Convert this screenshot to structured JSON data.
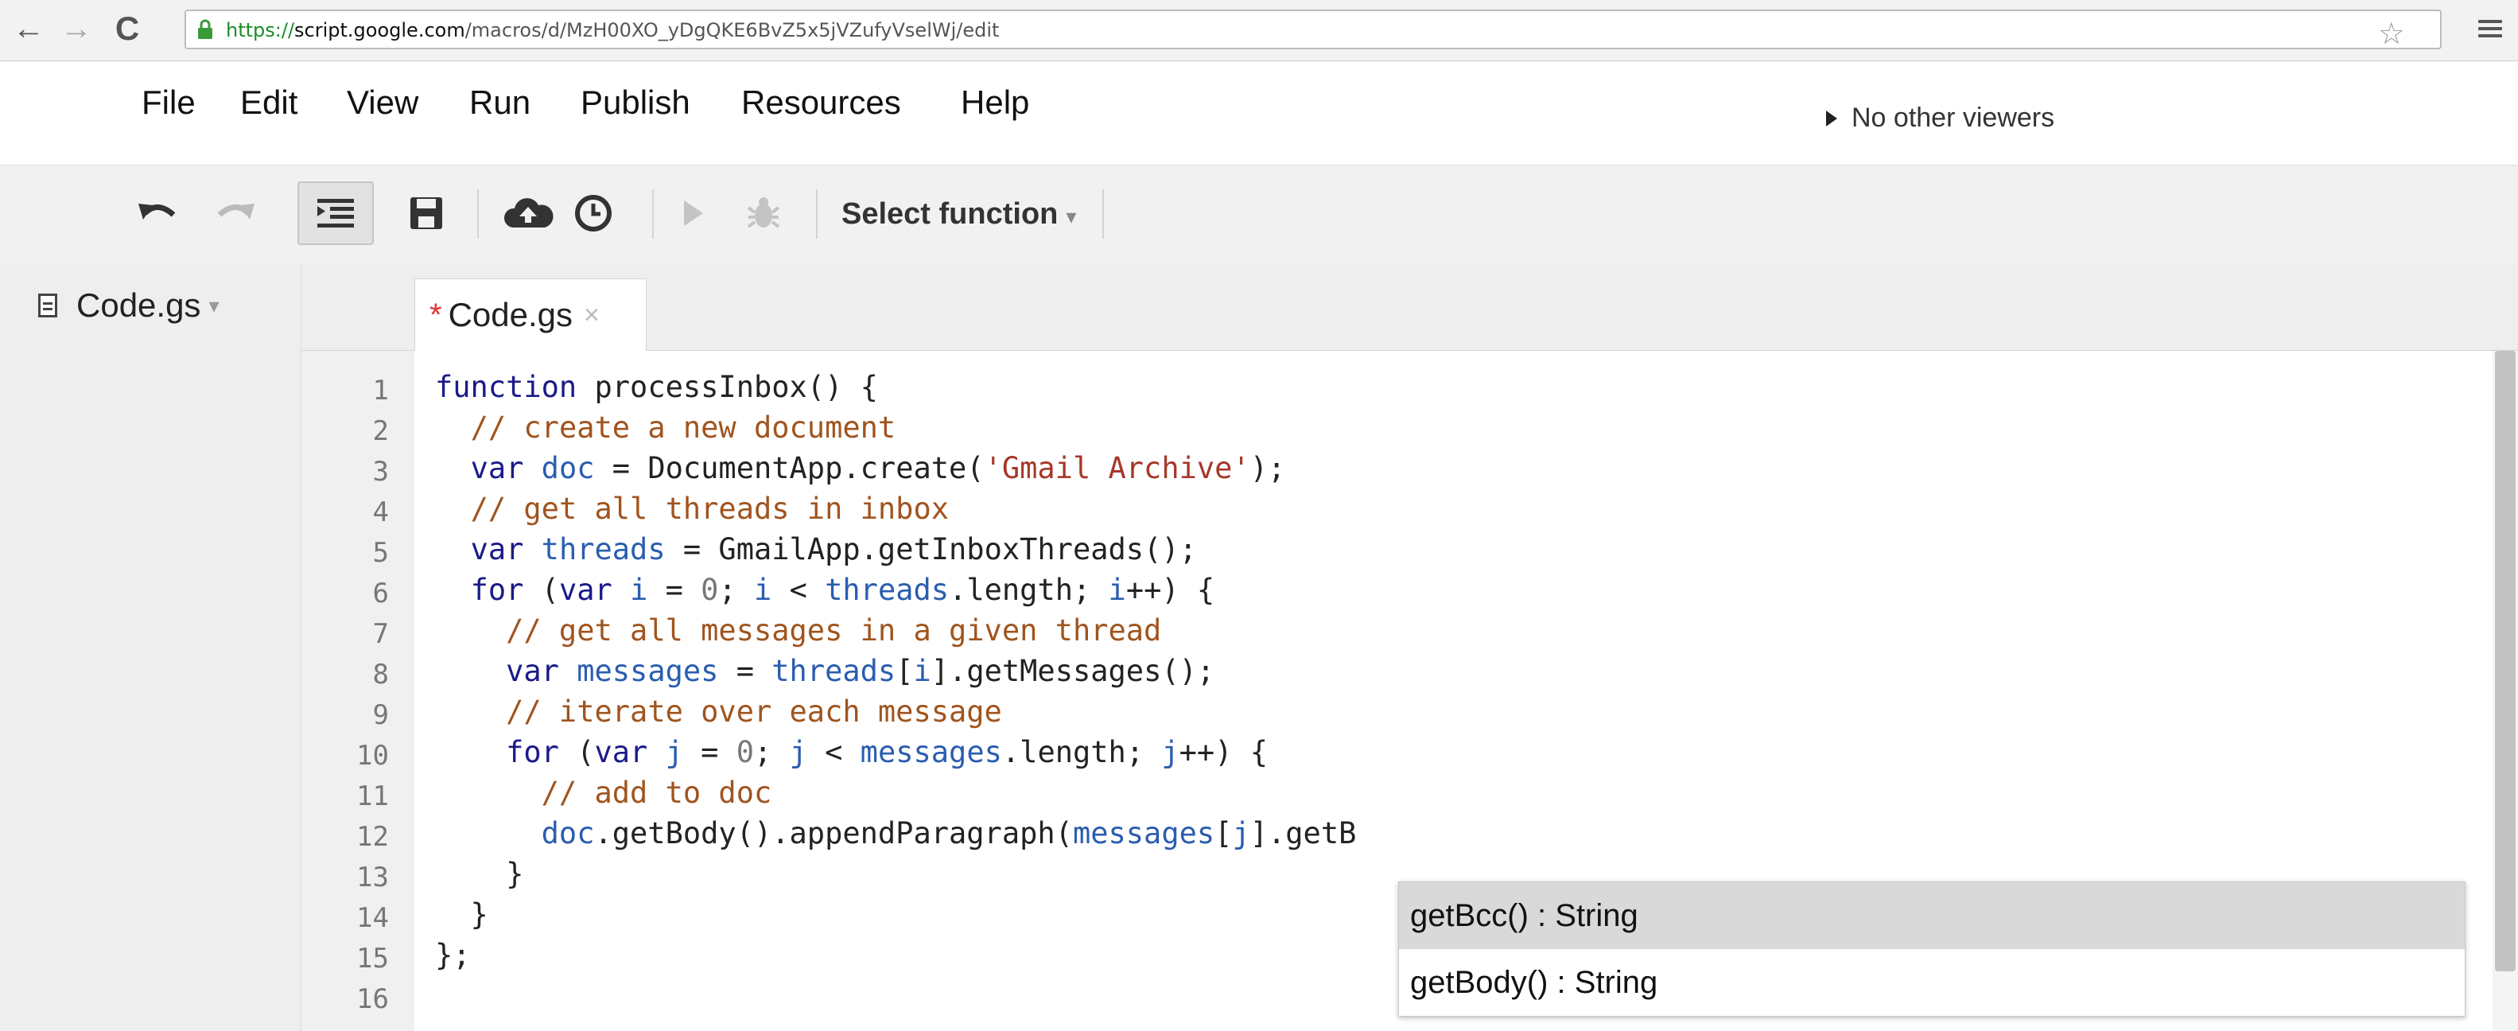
{
  "browser": {
    "url_protocol": "https",
    "url_host": "script.google.com",
    "url_path": "/macros/d/MzH00XO_yDgQKE6BvZ5x5jVZufyVselWj/edit"
  },
  "menu": {
    "items": [
      "File",
      "Edit",
      "View",
      "Run",
      "Publish",
      "Resources",
      "Help"
    ],
    "viewers": "No other viewers"
  },
  "toolbar": {
    "select_function": "Select function"
  },
  "files": {
    "sidebar_file": "Code.gs",
    "active_tab": "Code.gs",
    "tab_modified": "*",
    "tab_close": "×"
  },
  "editor": {
    "line_numbers": [
      "1",
      "2",
      "3",
      "4",
      "5",
      "6",
      "7",
      "8",
      "9",
      "10",
      "11",
      "12",
      "13",
      "14",
      "15",
      "16"
    ],
    "lines": [
      "function processInbox() {",
      "  // create a new document",
      "  var doc = DocumentApp.create('Gmail Archive');",
      "  // get all threads in inbox",
      "  var threads = GmailApp.getInboxThreads();",
      "  for (var i = 0; i < threads.length; i++) {",
      "    // get all messages in a given thread",
      "    var messages = threads[i].getMessages();",
      "    // iterate over each message",
      "    for (var j = 0; j < messages.length; j++) {",
      "      // add to doc",
      "      doc.getBody().appendParagraph(messages[j].getB",
      "    }",
      "  }",
      "};",
      ""
    ]
  },
  "autocomplete": {
    "items": [
      "getBcc() : String",
      "getBody() : String"
    ],
    "selected_index": 0
  }
}
